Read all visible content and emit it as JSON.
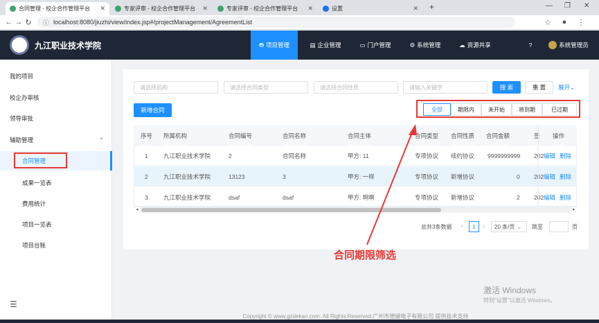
{
  "browser": {
    "tabs": [
      {
        "label": "合同管理 - 校企合作管理平台"
      },
      {
        "label": "专家评审 - 校企合作管理平台"
      },
      {
        "label": "专家评审 - 校企合作管理平台"
      },
      {
        "label": "设置"
      }
    ],
    "url": "localhost:8080/jiuzhi/view/index.jsp#/projectManagement/AgreementList"
  },
  "header": {
    "app_name": "九江职业技术学院",
    "nav": [
      "项目管理",
      "企业管理",
      "门户管理",
      "系统管理",
      "资源共享"
    ],
    "user": "系统管理员"
  },
  "sidebar": {
    "items": [
      "我的项目",
      "校企办审核",
      "领导审批",
      "辅助管理"
    ],
    "sub_items": [
      "合同管理",
      "成果一览表",
      "费用统计",
      "项目一览表",
      "项目台账"
    ]
  },
  "filters": {
    "org_placeholder": "请选择机构",
    "type_placeholder": "请选择合同类型",
    "nature_placeholder": "请选择合同性质",
    "keyword_placeholder": "请输入关键字",
    "search_label": "搜 索",
    "reset_label": "重 置",
    "expand_label": "展开"
  },
  "toolbar": {
    "new_label": "新增合同",
    "periods": [
      "全部",
      "期限内",
      "未开始",
      "将到期",
      "已过期"
    ]
  },
  "table": {
    "headers": [
      "序号",
      "所属机构",
      "合同编号",
      "合同名称",
      "合同主体",
      "合同类型",
      "合同性质",
      "合同金额",
      "签",
      "操作"
    ],
    "rows": [
      {
        "idx": "1",
        "org": "九江职业技术学院",
        "code": "2",
        "name": "合同名称",
        "party": "甲方: 11",
        "type": "专项协议",
        "nature": "续约协议",
        "amount": "9999999999",
        "sign": "202",
        "edit": "编辑",
        "del": "删除"
      },
      {
        "idx": "2",
        "org": "九江职业技术学院",
        "code": "13123",
        "name": "3",
        "party": "甲方: 一样",
        "type": "专项协议",
        "nature": "新增协议",
        "amount": "0",
        "sign": "202",
        "edit": "编辑",
        "del": "删除"
      },
      {
        "idx": "3",
        "org": "九江职业技术学院",
        "code": "dsaf",
        "name": "dsaf",
        "party": "甲方: 啊啊",
        "type": "专项协议",
        "nature": "新增协议",
        "amount": "2",
        "sign": "202",
        "edit": "编辑",
        "del": "删除"
      }
    ]
  },
  "pagination": {
    "total": "总共3条数据",
    "page": "1",
    "size": "20 条/页",
    "goto": "跳至",
    "page_unit": "页"
  },
  "annotation": "合同期限筛选",
  "footer": "Copyright © www.gzdekan.com. All Rights Reserved.广州市德键电子有限公司 提供技术支持",
  "watermark": {
    "line1": "激活 Windows",
    "line2": "转到\"设置\"以激活 Windows。"
  },
  "colors": {
    "primary": "#1e90ff",
    "header_bg": "#1f2737",
    "annotation": "#e53935"
  }
}
